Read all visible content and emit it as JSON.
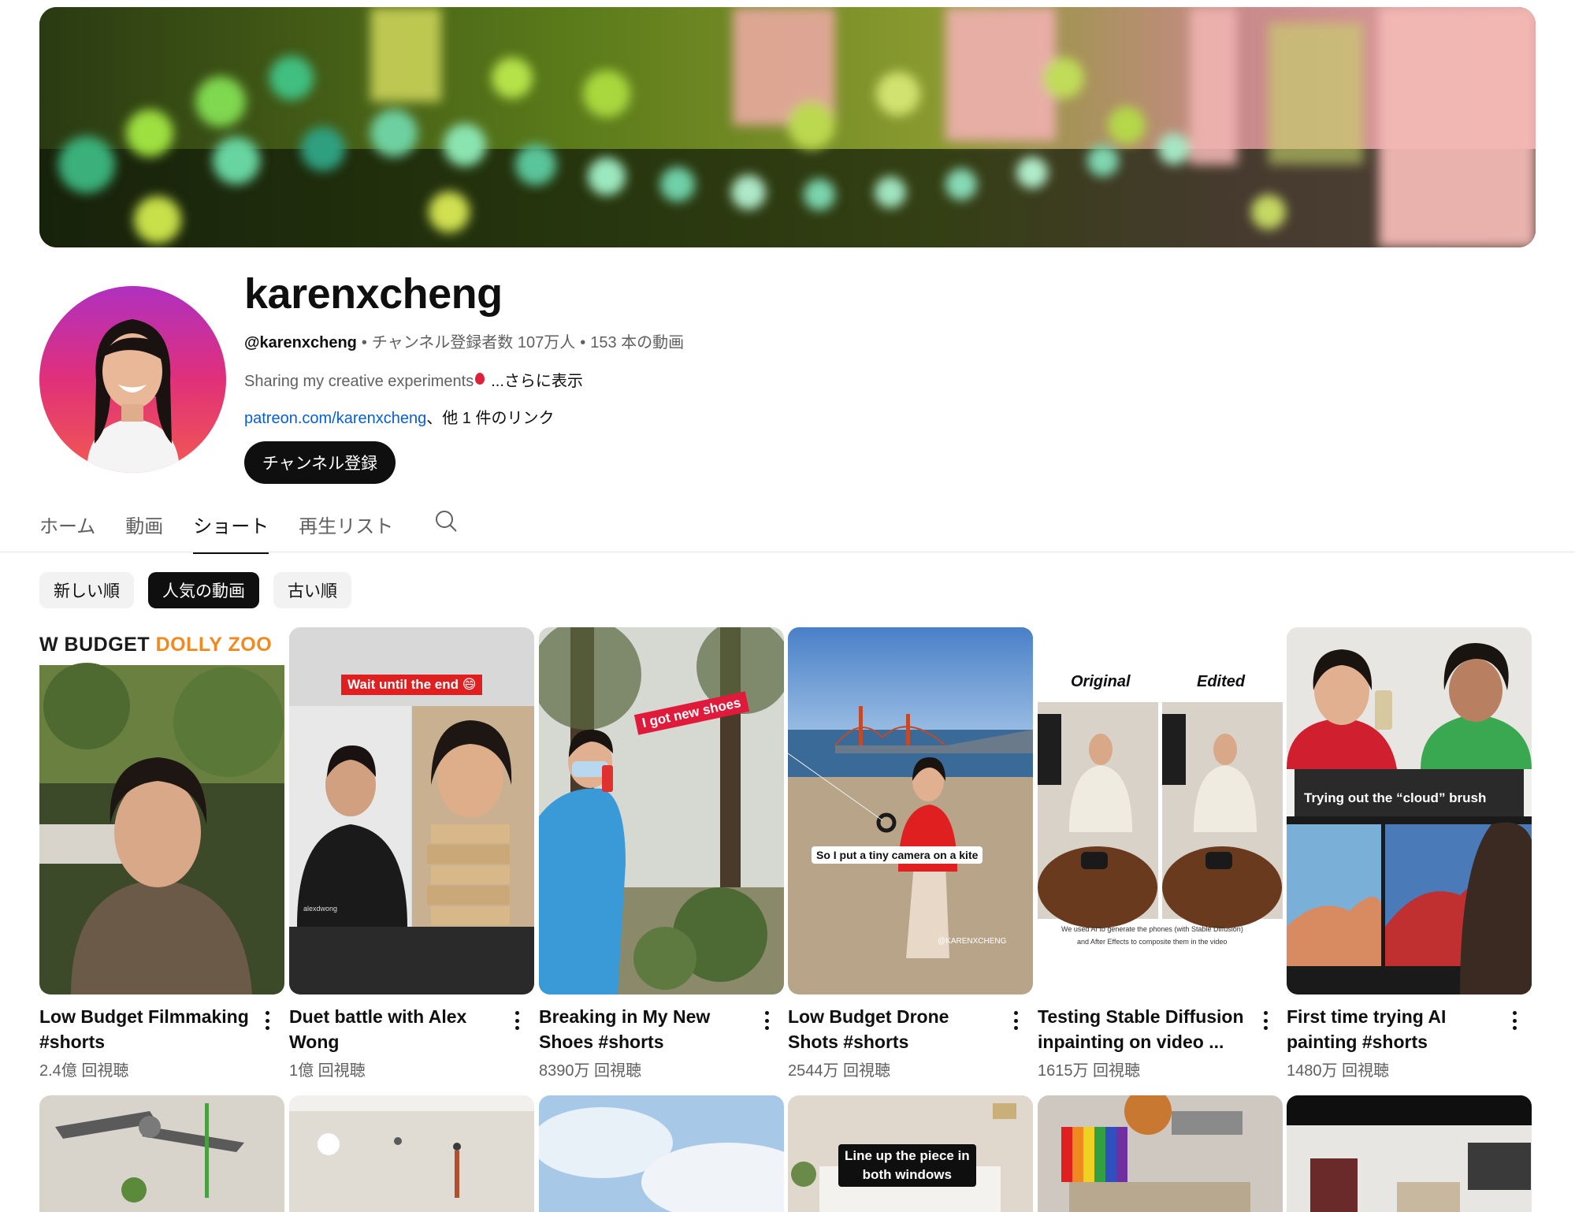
{
  "channel": {
    "name": "karenxcheng",
    "handle": "@karenxcheng",
    "subscribers": "チャンネル登録者数 107万人",
    "video_count": "153 本の動画",
    "separator": "•",
    "description": "Sharing my creative experiments",
    "more_label": "...さらに表示",
    "link_url": "patreon.com/karenxcheng",
    "link_suffix": "、他 1 件のリンク",
    "subscribe_label": "チャンネル登録"
  },
  "tabs": [
    {
      "label": "ホーム",
      "active": false
    },
    {
      "label": "動画",
      "active": false
    },
    {
      "label": "ショート",
      "active": true
    },
    {
      "label": "再生リスト",
      "active": false
    }
  ],
  "chips": [
    {
      "label": "新しい順",
      "active": false
    },
    {
      "label": "人気の動画",
      "active": true
    },
    {
      "label": "古い順",
      "active": false
    }
  ],
  "shorts": [
    {
      "title": "Low Budget Filmmaking #shorts",
      "views": "2.4億 回視聴",
      "overlay": "W BUDGET",
      "overlay2": "DOLLY ZOO"
    },
    {
      "title": "Duet battle with Alex Wong",
      "views": "1億 回視聴",
      "overlay": "Wait until the end 😄",
      "watermark": "alexdwong"
    },
    {
      "title": "Breaking in My New Shoes #shorts",
      "views": "8390万 回視聴",
      "overlay": "I got new shoes"
    },
    {
      "title": "Low Budget Drone Shots #shorts",
      "views": "2544万 回視聴",
      "overlay": "So I put a tiny camera on a kite",
      "watermark": "@KARENXCHENG"
    },
    {
      "title": "Testing Stable Diffusion inpainting on video ...",
      "views": "1615万 回視聴",
      "label_left": "Original",
      "label_right": "Edited",
      "caption1": "We used AI to generate the phones (with Stable Diffusion)",
      "caption2": "and After Effects to composite them in the video"
    },
    {
      "title": "First time trying AI painting #shorts",
      "views": "1480万 回視聴",
      "overlay": "Trying out the “cloud” brush"
    }
  ],
  "row2": [
    {
      "overlay": ""
    },
    {
      "overlay": ""
    },
    {
      "overlay": ""
    },
    {
      "overlay": "Line up the piece in",
      "overlay2": "both windows"
    },
    {
      "overlay": ""
    },
    {
      "overlay": ""
    }
  ]
}
